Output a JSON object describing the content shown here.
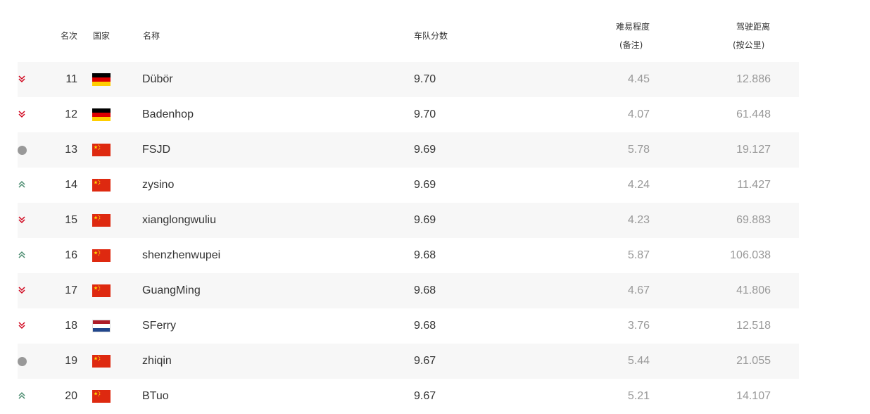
{
  "headers": {
    "rank": "名次",
    "country": "国家",
    "name": "名称",
    "score": "车队分数",
    "difficulty_line1": "难易程度",
    "difficulty_line2": "(备注)",
    "distance_line1": "驾驶距离",
    "distance_line2": "(按公里)"
  },
  "colors": {
    "down": "#d0021b",
    "up": "#4a8b6f",
    "same": "#999999",
    "stripe": "#f7f7f7"
  },
  "rows": [
    {
      "trend": "down",
      "rank": "11",
      "flag": "germany-flag",
      "name": "Dübör",
      "score": "9.70",
      "difficulty": "4.45",
      "distance": "12.886"
    },
    {
      "trend": "down",
      "rank": "12",
      "flag": "germany-flag",
      "name": "Badenhop",
      "score": "9.70",
      "difficulty": "4.07",
      "distance": "61.448"
    },
    {
      "trend": "same",
      "rank": "13",
      "flag": "china-flag",
      "name": "FSJD",
      "score": "9.69",
      "difficulty": "5.78",
      "distance": "19.127"
    },
    {
      "trend": "up",
      "rank": "14",
      "flag": "china-flag",
      "name": "zysino",
      "score": "9.69",
      "difficulty": "4.24",
      "distance": "11.427"
    },
    {
      "trend": "down",
      "rank": "15",
      "flag": "china-flag",
      "name": "xianglongwuliu",
      "score": "9.69",
      "difficulty": "4.23",
      "distance": "69.883"
    },
    {
      "trend": "up",
      "rank": "16",
      "flag": "china-flag",
      "name": "shenzhenwupei",
      "score": "9.68",
      "difficulty": "5.87",
      "distance": "106.038"
    },
    {
      "trend": "down",
      "rank": "17",
      "flag": "china-flag",
      "name": "GuangMing",
      "score": "9.68",
      "difficulty": "4.67",
      "distance": "41.806"
    },
    {
      "trend": "down",
      "rank": "18",
      "flag": "netherlands-flag",
      "name": "SFerry",
      "score": "9.68",
      "difficulty": "3.76",
      "distance": "12.518"
    },
    {
      "trend": "same",
      "rank": "19",
      "flag": "china-flag",
      "name": "zhiqin",
      "score": "9.67",
      "difficulty": "5.44",
      "distance": "21.055"
    },
    {
      "trend": "up",
      "rank": "20",
      "flag": "china-flag",
      "name": "BTuo",
      "score": "9.67",
      "difficulty": "5.21",
      "distance": "14.107"
    }
  ]
}
